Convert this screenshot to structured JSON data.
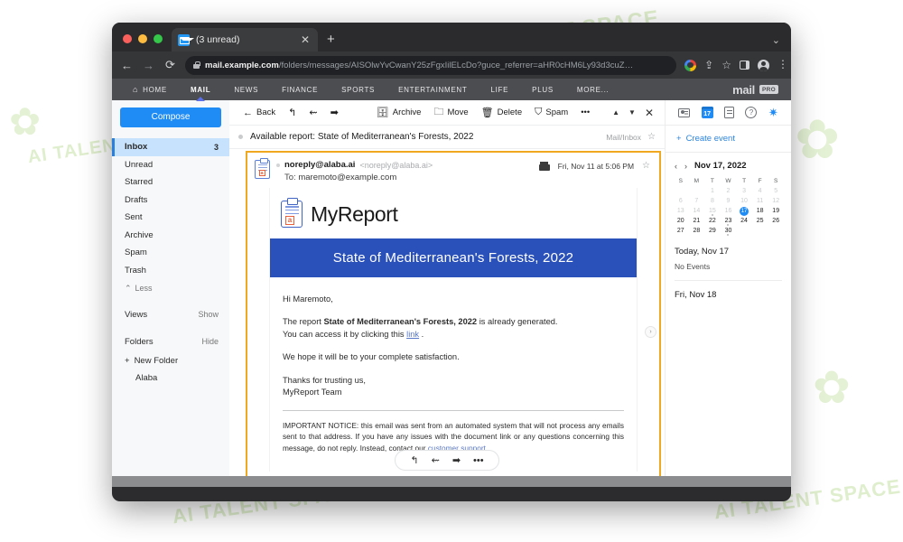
{
  "browser": {
    "tab": {
      "title": "(3 unread)",
      "favicon": "mail-icon",
      "close": "✕"
    },
    "new_tab": "+",
    "window_collapse": "⌄",
    "nav": {
      "back": "←",
      "forward": "→",
      "reload": "⟳"
    },
    "omnibox": {
      "host": "mail.example.com",
      "path": "/folders/messages/AISOlwYvCwanY25zFgxIilELcDo?guce_referrer=aHR0cHM6Ly93d3cuZ…",
      "lock": "lock-icon"
    },
    "toolbar_icons": [
      "google-icon",
      "share-icon",
      "bookmark-star-icon",
      "side-panel-icon",
      "profile-avatar-icon",
      "chrome-menu-icon"
    ]
  },
  "mail_nav": {
    "items": [
      {
        "label": "HOME",
        "icon": "home-icon",
        "active": false
      },
      {
        "label": "MAIL",
        "icon": "",
        "active": true
      },
      {
        "label": "NEWS",
        "icon": "",
        "active": false
      },
      {
        "label": "FINANCE",
        "icon": "",
        "active": false
      },
      {
        "label": "SPORTS",
        "icon": "",
        "active": false
      },
      {
        "label": "ENTERTAINMENT",
        "icon": "",
        "active": false
      },
      {
        "label": "LIFE",
        "icon": "",
        "active": false
      },
      {
        "label": "PLUS",
        "icon": "",
        "active": false
      },
      {
        "label": "MORE...",
        "icon": "",
        "active": false
      }
    ],
    "brand": "mail",
    "brand_badge": "PRO"
  },
  "sidebar": {
    "compose": "Compose",
    "folders": [
      {
        "label": "Inbox",
        "count": "3",
        "selected": true
      },
      {
        "label": "Unread",
        "count": "",
        "selected": false
      },
      {
        "label": "Starred",
        "count": "",
        "selected": false
      },
      {
        "label": "Drafts",
        "count": "",
        "selected": false
      },
      {
        "label": "Sent",
        "count": "",
        "selected": false
      },
      {
        "label": "Archive",
        "count": "",
        "selected": false
      },
      {
        "label": "Spam",
        "count": "",
        "selected": false
      },
      {
        "label": "Trash",
        "count": "",
        "selected": false
      }
    ],
    "less": "Less",
    "views": {
      "label": "Views",
      "action": "Show"
    },
    "folders_section": {
      "label": "Folders",
      "action": "Hide"
    },
    "new_folder": "New Folder",
    "custom_folder": "Alaba"
  },
  "toolbar": {
    "back": "Back",
    "reply": "reply-icon",
    "reply_all": "reply-all-icon",
    "forward": "forward-icon",
    "archive": "Archive",
    "move": "Move",
    "delete": "Delete",
    "spam": "Spam",
    "more": "•••",
    "prev": "▲",
    "next": "▼",
    "close": "✕"
  },
  "subject_row": {
    "subject": "Available report: State of Mediterranean's Forests, 2022",
    "folder": "Mail/Inbox",
    "star": "☆"
  },
  "message": {
    "sender_name": "noreply@alaba.ai",
    "sender_email": "<noreply@alaba.ai>",
    "to_label": "To:",
    "to_value": "maremoto@example.com",
    "date": "Fri, Nov 11 at 5:06 PM",
    "print": "print-icon",
    "star": "☆"
  },
  "report": {
    "brand": "MyReport",
    "brand_mark": "a",
    "banner_title": "State of Mediterranean's Forests, 2022",
    "greeting": "Hi Maremoto,",
    "para1_pre": "The report ",
    "para1_bold": "State of Mediterranean's Forests, 2022",
    "para1_post": " is already generated.",
    "para1_line2_pre": "You can access it by clicking this ",
    "para1_link": "link",
    "para1_line2_post": " .",
    "para2": "We hope it will be to your complete satisfaction.",
    "para3_line1": "Thanks for trusting us,",
    "para3_line2": "MyReport Team",
    "notice_pre": "IMPORTANT NOTICE: this email was sent from an automated system that will not process any emails sent to that address. If you have any issues with the document link or any questions concerning this message, do not reply. Instead, contact our ",
    "notice_link": "customer support",
    "notice_post": " ."
  },
  "reply_bar": {
    "reply": "reply-icon",
    "reply_all": "reply-all-icon",
    "forward": "forward-icon",
    "more": "•••"
  },
  "side_chevron": "›",
  "rail": {
    "icons": [
      "contacts-icon",
      "calendar-icon",
      "notepad-icon",
      "help-icon",
      "settings-gear-icon"
    ],
    "calendar_day": "17",
    "create_event": "Create event",
    "create_event_plus": "+",
    "cal_prev": "‹",
    "cal_next": "›",
    "cal_title": "Nov 17, 2022",
    "dow": [
      "S",
      "M",
      "T",
      "W",
      "T",
      "F",
      "S"
    ],
    "weeks": [
      [
        {
          "d": "",
          "s": "blank"
        },
        {
          "d": "",
          "s": "blank"
        },
        {
          "d": "1",
          "s": "past"
        },
        {
          "d": "2",
          "s": "past"
        },
        {
          "d": "3",
          "s": "past"
        },
        {
          "d": "4",
          "s": "past"
        },
        {
          "d": "5",
          "s": "past"
        }
      ],
      [
        {
          "d": "6",
          "s": "past"
        },
        {
          "d": "7",
          "s": "past"
        },
        {
          "d": "8",
          "s": "past"
        },
        {
          "d": "9",
          "s": "past"
        },
        {
          "d": "10",
          "s": "past"
        },
        {
          "d": "11",
          "s": "past"
        },
        {
          "d": "12",
          "s": "past"
        }
      ],
      [
        {
          "d": "13",
          "s": "past"
        },
        {
          "d": "14",
          "s": "past"
        },
        {
          "d": "15",
          "s": "past dot"
        },
        {
          "d": "16",
          "s": "past"
        },
        {
          "d": "17",
          "s": "today"
        },
        {
          "d": "18",
          "s": "normal"
        },
        {
          "d": "19",
          "s": "normal"
        }
      ],
      [
        {
          "d": "20",
          "s": "normal"
        },
        {
          "d": "21",
          "s": "normal"
        },
        {
          "d": "22",
          "s": "normal"
        },
        {
          "d": "23",
          "s": "normal dot"
        },
        {
          "d": "24",
          "s": "normal"
        },
        {
          "d": "25",
          "s": "normal"
        },
        {
          "d": "26",
          "s": "normal"
        }
      ],
      [
        {
          "d": "27",
          "s": "normal"
        },
        {
          "d": "28",
          "s": "normal"
        },
        {
          "d": "29",
          "s": "normal"
        },
        {
          "d": "30",
          "s": "normal dot"
        },
        {
          "d": "",
          "s": "blank"
        },
        {
          "d": "",
          "s": "blank"
        },
        {
          "d": "",
          "s": "blank"
        }
      ]
    ],
    "today_label": "Today, Nov 17",
    "no_events": "No Events",
    "next_day_label": "Fri, Nov 18"
  },
  "colors": {
    "accent_blue": "#1f8bf5",
    "banner_blue": "#2a50b9",
    "highlight_orange": "#f0a821",
    "selected_row": "#c6e2fd",
    "link_blue": "#5a78c8"
  },
  "watermarks": [
    "AI TALENT SPACE",
    "AI TALENT SPACE",
    "AI TALENT SPACE",
    "AI TALENT SPACE"
  ]
}
